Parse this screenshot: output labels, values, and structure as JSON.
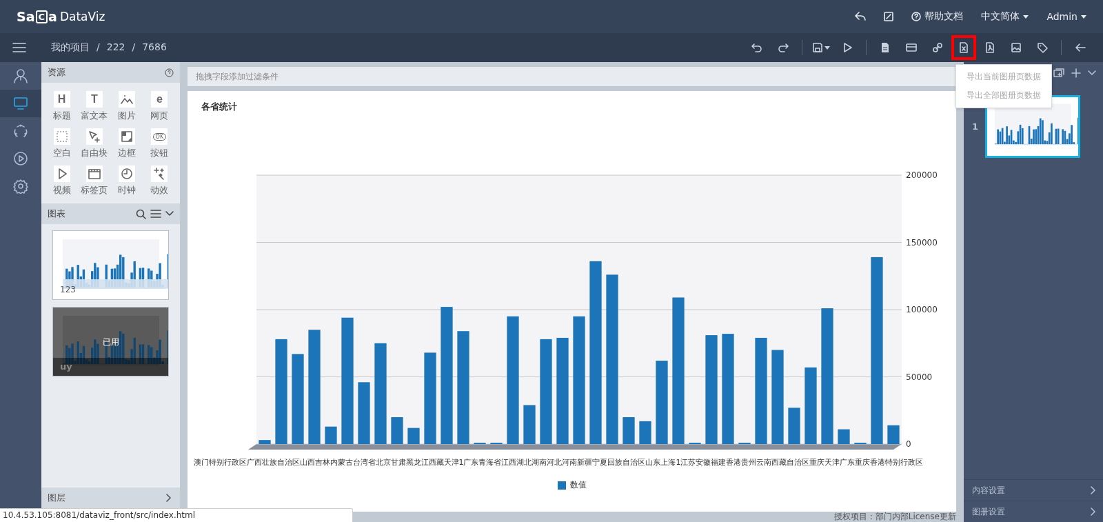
{
  "header": {
    "logo": {
      "prefix": "Sa",
      "boxed": "C",
      "suffix": "a",
      "name": "DataViz"
    },
    "actions": [
      {
        "kind": "back"
      },
      {
        "kind": "edit"
      },
      {
        "kind": "help",
        "label": "帮助文档"
      },
      {
        "kind": "dropdown",
        "label": "中文简体"
      },
      {
        "kind": "dropdown",
        "label": "Admin"
      }
    ]
  },
  "toolbar": {
    "breadcrumb": [
      "我的项目",
      "222",
      "7686"
    ],
    "separator": "/",
    "tools": [
      {
        "kind": "undo",
        "highlighted": false
      },
      {
        "kind": "redo",
        "highlighted": false
      },
      {
        "kind": "divider"
      },
      {
        "kind": "save",
        "highlighted": false
      },
      {
        "kind": "play",
        "highlighted": false
      },
      {
        "kind": "divider"
      },
      {
        "kind": "doc",
        "highlighted": false
      },
      {
        "kind": "card",
        "highlighted": false
      },
      {
        "kind": "link",
        "highlighted": false
      },
      {
        "kind": "excel",
        "highlighted": true
      },
      {
        "kind": "pdf",
        "highlighted": false
      },
      {
        "kind": "image",
        "highlighted": false
      },
      {
        "kind": "tag",
        "highlighted": false
      },
      {
        "kind": "divider"
      },
      {
        "kind": "exit",
        "highlighted": false
      }
    ]
  },
  "rail": [
    {
      "kind": "user",
      "selected": false
    },
    {
      "kind": "screen",
      "selected": true
    },
    {
      "kind": "cycle",
      "selected": false
    },
    {
      "kind": "play",
      "selected": false
    },
    {
      "kind": "gear",
      "selected": false
    }
  ],
  "resources": {
    "title": "资源",
    "items": [
      {
        "label": "标题",
        "kind": "glyph",
        "glyph": "H"
      },
      {
        "label": "富文本",
        "kind": "glyph",
        "glyph": "T"
      },
      {
        "label": "图片",
        "kind": "picture"
      },
      {
        "label": "网页",
        "kind": "glyph",
        "glyph": "e"
      },
      {
        "label": "空白",
        "kind": "blank"
      },
      {
        "label": "自由块",
        "kind": "pointer"
      },
      {
        "label": "边框",
        "kind": "frame"
      },
      {
        "label": "按钮",
        "kind": "pill",
        "glyph": "OK"
      },
      {
        "label": "视频",
        "kind": "video"
      },
      {
        "label": "标签页",
        "kind": "tabs"
      },
      {
        "label": "时钟",
        "kind": "clock"
      },
      {
        "label": "动效",
        "kind": "sparkle"
      }
    ]
  },
  "charts": {
    "title": "图表",
    "cards": [
      {
        "caption": "123",
        "used": false
      },
      {
        "caption": "uy",
        "used": true,
        "badge": "已用"
      }
    ]
  },
  "layers": {
    "title": "图层"
  },
  "filter_hint": "拖拽字段添加过滤条件",
  "chart_card": {
    "title": "各省统计",
    "x_axis_labels": "澳门特别行政区广西壮族自治区山西吉林内蒙古台湾省北京甘肃黑龙江西藏天津1广东青海省江西湖北湖南河北河南新疆宁夏回族自治区山东上海1江苏安徽福建香港贵州云南西藏自治区重庆天津广东重庆香港特别行政区",
    "chart_data": {
      "type": "bar",
      "grid": true,
      "ylim": [
        0,
        200000
      ],
      "yticks": [
        0,
        50000,
        100000,
        150000,
        200000
      ],
      "series": [
        {
          "name": "数值",
          "color": "#1c75b8",
          "values": [
            3000,
            78000,
            67000,
            85000,
            13000,
            94000,
            46000,
            75000,
            20000,
            12000,
            68000,
            102000,
            84000,
            1000,
            1000,
            95000,
            29000,
            78000,
            79000,
            95000,
            136000,
            126000,
            20000,
            17000,
            62000,
            109000,
            1000,
            81000,
            82000,
            1000,
            79000,
            70000,
            27000,
            57000,
            101000,
            11000,
            1000,
            139000,
            14000
          ]
        }
      ]
    }
  },
  "license": "授权项目：部门内部License更新",
  "export_menu": {
    "items": [
      {
        "label": "导出当前图册页数据",
        "disabled": true
      },
      {
        "label": "导出全部图册页数据",
        "disabled": true
      }
    ]
  },
  "pages": {
    "items": [
      {
        "number": "1",
        "selected": true
      }
    ]
  },
  "settings": [
    "内容设置",
    "图册设置"
  ],
  "status_url": "10.4.53.105:8081/dataviz_front/src/index.html"
}
